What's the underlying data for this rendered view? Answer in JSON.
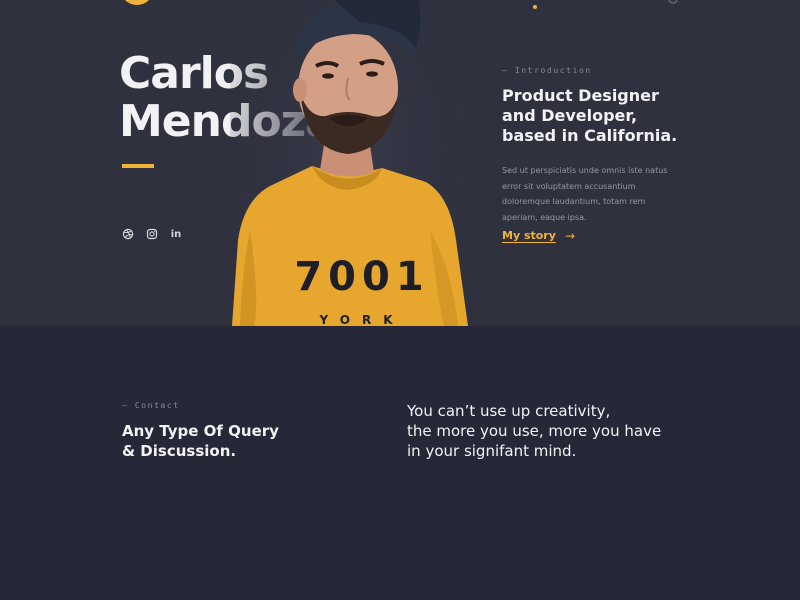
{
  "hero": {
    "name_line1": "Carlos",
    "name_line2": "Mendoza.",
    "socials": [
      {
        "icon": "dribbble-icon"
      },
      {
        "icon": "instagram-icon"
      },
      {
        "icon": "linkedin-icon",
        "text": "in"
      }
    ]
  },
  "intro": {
    "label": "— Introduction",
    "title": "Product Designer and Developer, based in California.",
    "body": "Sed ut perspiciatis unde omnis iste natus error sit voluptatem accusantium doloremque laudantium, totam rem aperiam, eaque ipsa.",
    "link": "My story",
    "arrow": "→"
  },
  "contact": {
    "label": "— Contact",
    "title_line1": "Any Type Of Query",
    "title_line2": "& Discussion."
  },
  "quote": {
    "line1": "You can’t use up creativity,",
    "line2": "the more you use, more you have",
    "line3": "in your signifant mind."
  },
  "photo": {
    "shirt_text": "7001",
    "shirt_text2": "YORK"
  },
  "colors": {
    "accent": "#f0b33a",
    "hero_bg": "#30313f",
    "bottom_bg": "#262837"
  }
}
